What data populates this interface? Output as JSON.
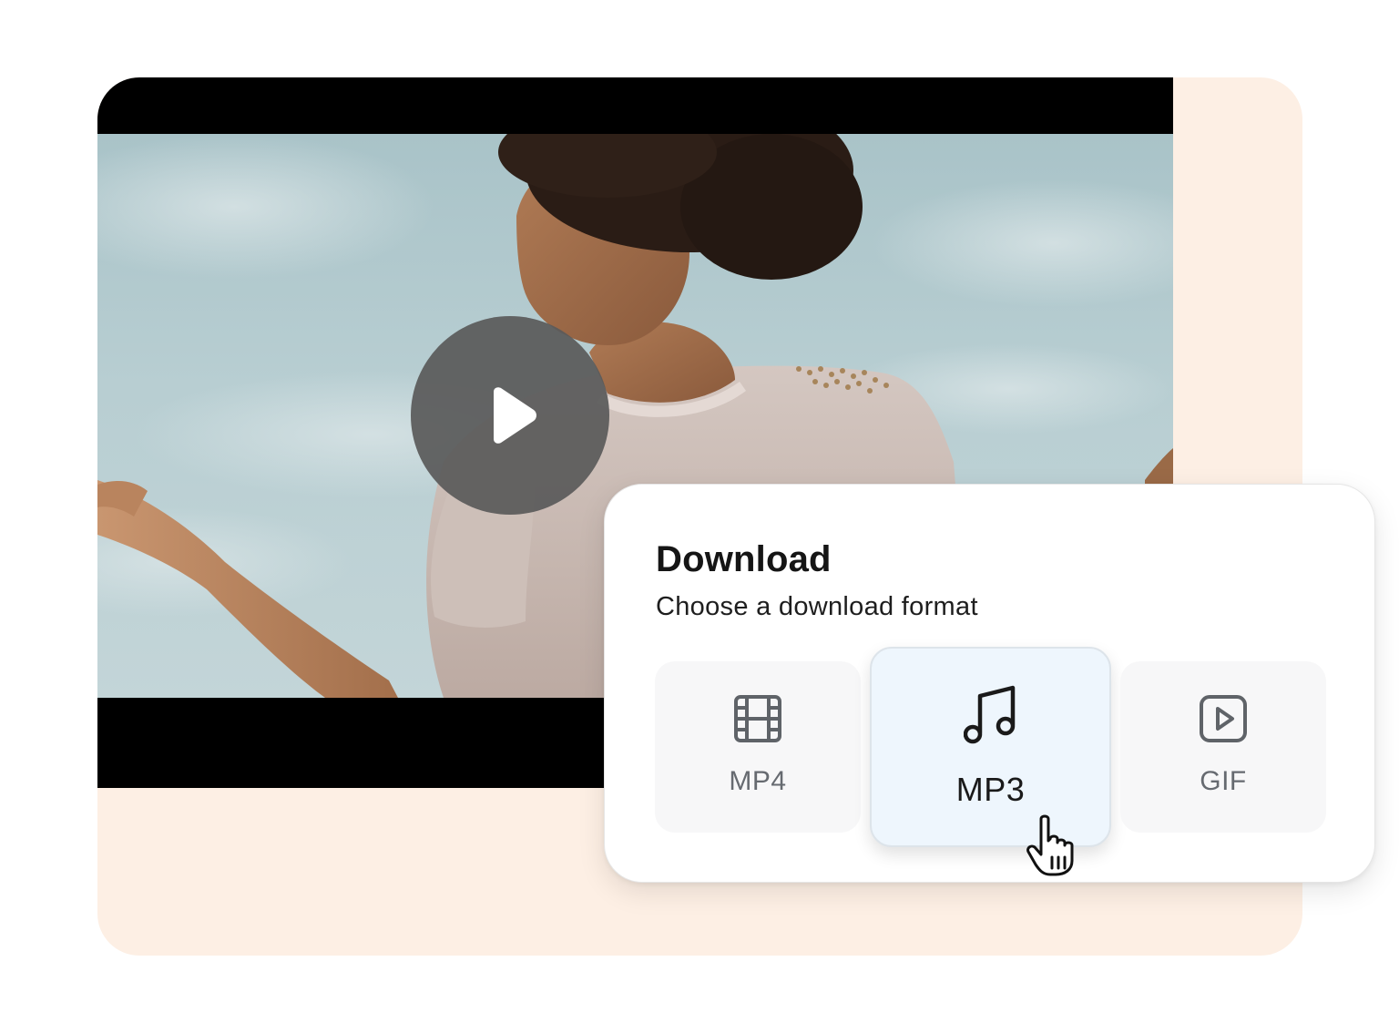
{
  "video": {
    "controls": {
      "play_icon": "play-icon"
    }
  },
  "download_panel": {
    "title": "Download",
    "subtitle": "Choose a download format",
    "options": [
      {
        "label": "MP4",
        "icon": "film-icon",
        "selected": false
      },
      {
        "label": "MP3",
        "icon": "music-note-icon",
        "selected": true
      },
      {
        "label": "GIF",
        "icon": "play-square-icon",
        "selected": false
      }
    ]
  },
  "colors": {
    "backdrop": "#fdefe4",
    "selected_option_bg": "#eef6fd",
    "option_bg": "#f7f7f8"
  },
  "cursor": {
    "icon": "hand-pointer-icon"
  }
}
